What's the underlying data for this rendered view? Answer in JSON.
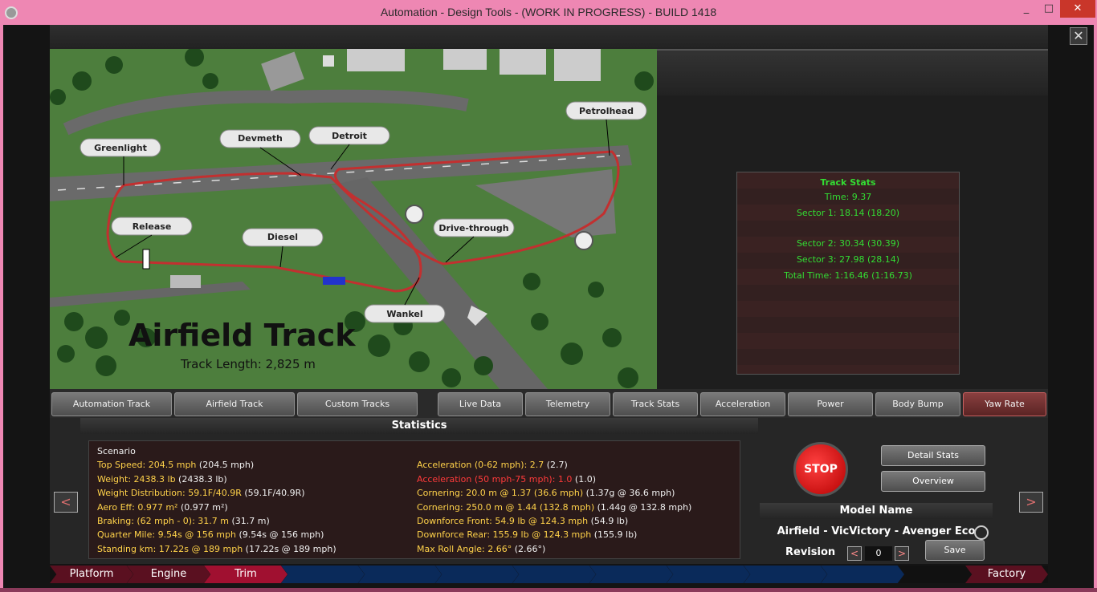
{
  "window": {
    "title": "Automation - Design Tools - (WORK IN PROGRESS) - BUILD 1418",
    "minimize": "_",
    "maximize": "□",
    "close": "✕"
  },
  "panel_close": "✕",
  "map": {
    "title": "Airfield Track",
    "length": "Track Length: 2,825 m",
    "corners": [
      "Greenlight",
      "Devmeth",
      "Detroit",
      "Petrolhead",
      "Release",
      "Diesel",
      "Drive-through",
      "Wankel"
    ]
  },
  "track_stats": {
    "title": "Track Stats",
    "rows": [
      "Time: 9.37",
      "Sector 1: 18.14 (18.20)",
      "Sector 2: 30.34 (30.39)",
      "Sector 3: 27.98 (28.14)",
      "Total Time: 1:16.46 (1:16.73)"
    ]
  },
  "tabs": {
    "left": [
      "Automation Track",
      "Airfield Track",
      "Custom Tracks"
    ],
    "right": [
      "Live Data",
      "Telemetry",
      "Track Stats",
      "Acceleration",
      "Power",
      "Body Bump",
      "Yaw Rate"
    ]
  },
  "statistics": {
    "title": "Statistics",
    "scenario": "Scenario",
    "left": [
      {
        "label": "Top Speed: 204.5 mph",
        "value": " (204.5 mph)"
      },
      {
        "label": "Weight: 2438.3 lb",
        "value": " (2438.3 lb)"
      },
      {
        "label": "Weight Distribution: 59.1F/40.9R",
        "value": " (59.1F/40.9R)"
      },
      {
        "label": "Aero Eff: 0.977 m²",
        "value": " (0.977 m²)"
      },
      {
        "label": "Braking: (62 mph - 0): 31.7 m",
        "value": " (31.7 m)"
      },
      {
        "label": "Quarter Mile: 9.54s @ 156 mph",
        "value": " (9.54s @ 156 mph)"
      },
      {
        "label": "Standing km: 17.22s @ 189 mph",
        "value": " (17.22s @ 189 mph)"
      }
    ],
    "right": [
      {
        "label": "Acceleration (0-62 mph): 2.7",
        "value": " (2.7)"
      },
      {
        "label": "Acceleration (50 mph-75 mph): 1.0",
        "value": " (1.0)"
      },
      {
        "label": "Cornering: 20.0 m @ 1.37 (36.6 mph)",
        "value": " (1.37g @ 36.6 mph)"
      },
      {
        "label": "Cornering: 250.0 m @ 1.44 (132.8 mph)",
        "value": " (1.44g @ 132.8 mph)"
      },
      {
        "label": "Downforce Front: 54.9 lb @ 124.3 mph",
        "value": " (54.9 lb)"
      },
      {
        "label": "Downforce Rear: 155.9 lb @ 124.3 mph",
        "value": " (155.9 lb)"
      },
      {
        "label": "Max Roll Angle: 2.66°",
        "value": " (2.66°)"
      }
    ]
  },
  "controls": {
    "prev": "<",
    "next": ">",
    "stop": "STOP",
    "detail_stats": "Detail Stats",
    "overview": "Overview",
    "model_name_title": "Model Name",
    "model_name": "Airfield - VicVictory - Avenger Eco",
    "revision_label": "Revision",
    "revision_value": "0",
    "rev_prev": "<",
    "rev_next": ">",
    "save": "Save"
  },
  "navbar": [
    "Platform",
    "Engine",
    "Trim",
    "",
    "",
    "",
    "",
    "",
    "",
    "",
    "Factory"
  ],
  "colors": {
    "window_frame": "#ee87b3",
    "stat_label": "#ffd24a",
    "stat_warning": "#ff3a3a",
    "track_stats_text": "#33dd33",
    "active_tab": "#8a4040"
  }
}
